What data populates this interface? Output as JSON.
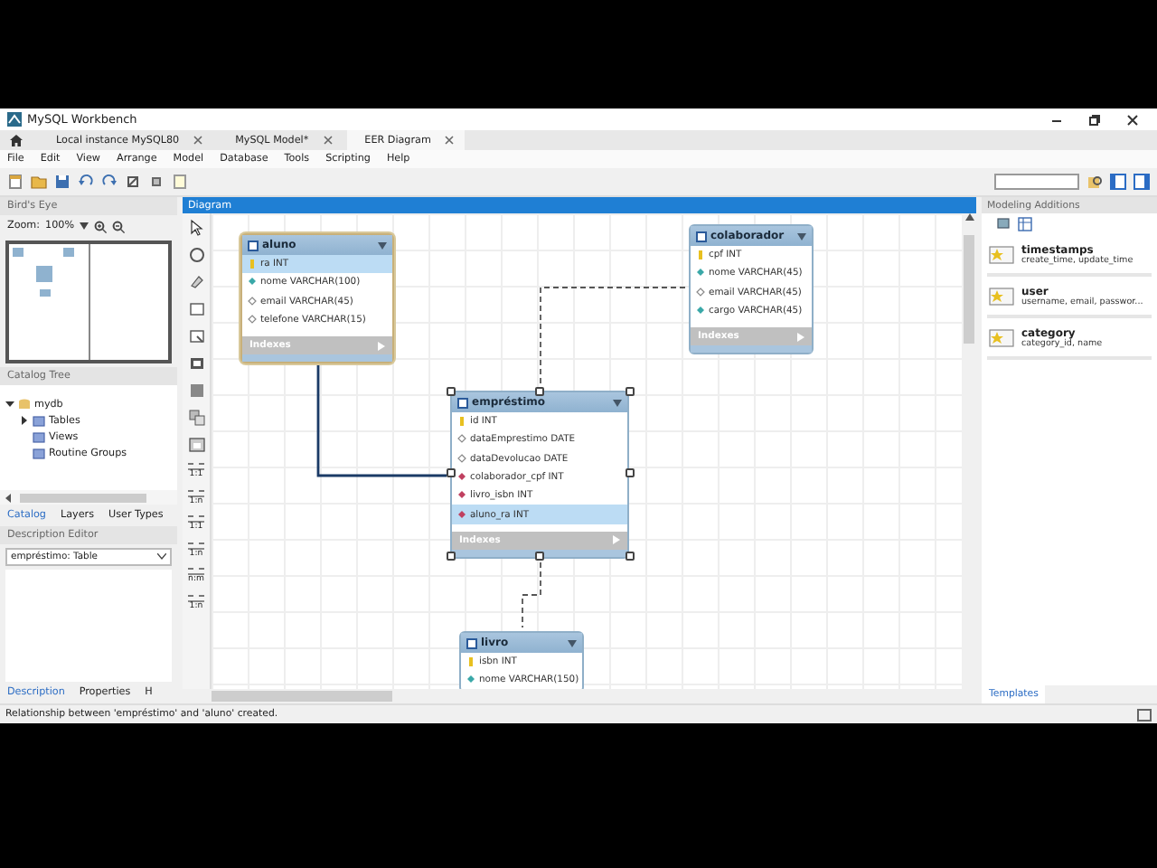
{
  "window": {
    "title": "MySQL Workbench"
  },
  "tabs": [
    {
      "label": "Local instance MySQL80",
      "selected": false
    },
    {
      "label": "MySQL Model*",
      "selected": false
    },
    {
      "label": "EER Diagram",
      "selected": true
    }
  ],
  "menu": [
    "File",
    "Edit",
    "View",
    "Arrange",
    "Model",
    "Database",
    "Tools",
    "Scripting",
    "Help"
  ],
  "left_panel": {
    "birds_eye_title": "Bird's Eye",
    "zoom_label": "Zoom:",
    "zoom_value": "100%",
    "catalog_title": "Catalog Tree",
    "tree": [
      {
        "label": "mydb",
        "expanded": true,
        "children": [
          {
            "label": "Tables",
            "expanded": false
          },
          {
            "label": "Views"
          },
          {
            "label": "Routine Groups"
          }
        ]
      }
    ],
    "catalog_tabs": [
      {
        "label": "Catalog",
        "selected": true
      },
      {
        "label": "Layers",
        "selected": false
      },
      {
        "label": "User Types",
        "selected": false
      }
    ],
    "description_title": "Description Editor",
    "object_select": "empréstimo: Table",
    "bottom_tabs": [
      {
        "label": "Description",
        "selected": true
      },
      {
        "label": "Properties",
        "selected": false
      },
      {
        "label": "H",
        "selected": false
      }
    ]
  },
  "diagram": {
    "title": "Diagram",
    "relationship_tools": [
      "1:1",
      "1:n",
      "1:1",
      "1:n",
      "n:m",
      "1:n"
    ],
    "tables": [
      {
        "name": "aluno",
        "hover": true,
        "selected": false,
        "footer": "Indexes",
        "columns": [
          {
            "text": "ra INT",
            "kind": "pk",
            "selected": true
          },
          {
            "text": "nome VARCHAR(100)",
            "kind": "nn",
            "selected": false
          },
          {
            "text": "email VARCHAR(45)",
            "kind": "col",
            "selected": false
          },
          {
            "text": "telefone VARCHAR(15)",
            "kind": "col",
            "selected": false
          }
        ]
      },
      {
        "name": "colaborador",
        "hover": false,
        "selected": false,
        "footer": "Indexes",
        "columns": [
          {
            "text": "cpf INT",
            "kind": "pk",
            "selected": false
          },
          {
            "text": "nome VARCHAR(45)",
            "kind": "nn",
            "selected": false
          },
          {
            "text": "email VARCHAR(45)",
            "kind": "col",
            "selected": false
          },
          {
            "text": "cargo VARCHAR(45)",
            "kind": "nn",
            "selected": false
          }
        ]
      },
      {
        "name": "empréstimo",
        "hover": false,
        "selected": true,
        "footer": "Indexes",
        "columns": [
          {
            "text": "id INT",
            "kind": "pk",
            "selected": false
          },
          {
            "text": "dataEmprestimo DATE",
            "kind": "col",
            "selected": false
          },
          {
            "text": "dataDevolucao DATE",
            "kind": "col",
            "selected": false
          },
          {
            "text": "colaborador_cpf INT",
            "kind": "fk",
            "selected": false
          },
          {
            "text": "livro_isbn INT",
            "kind": "fk",
            "selected": false
          },
          {
            "text": "aluno_ra INT",
            "kind": "fk",
            "selected": true
          }
        ]
      },
      {
        "name": "livro",
        "hover": false,
        "selected": false,
        "columns": [
          {
            "text": "isbn INT",
            "kind": "pk",
            "selected": false
          },
          {
            "text": "nome VARCHAR(150)",
            "kind": "nn",
            "selected": false
          }
        ]
      }
    ],
    "relationships": [
      {
        "identifying": true
      },
      {
        "identifying": false
      },
      {
        "identifying": false
      }
    ]
  },
  "right_panel": {
    "title": "Modeling Additions",
    "items": [
      {
        "name": "timestamps",
        "detail": "create_time, update_time"
      },
      {
        "name": "user",
        "detail": "username, email, passwor..."
      },
      {
        "name": "category",
        "detail": "category_id, name"
      }
    ],
    "tab": "Templates"
  },
  "status_bar": "Relationship between 'empréstimo' and 'aluno' created."
}
